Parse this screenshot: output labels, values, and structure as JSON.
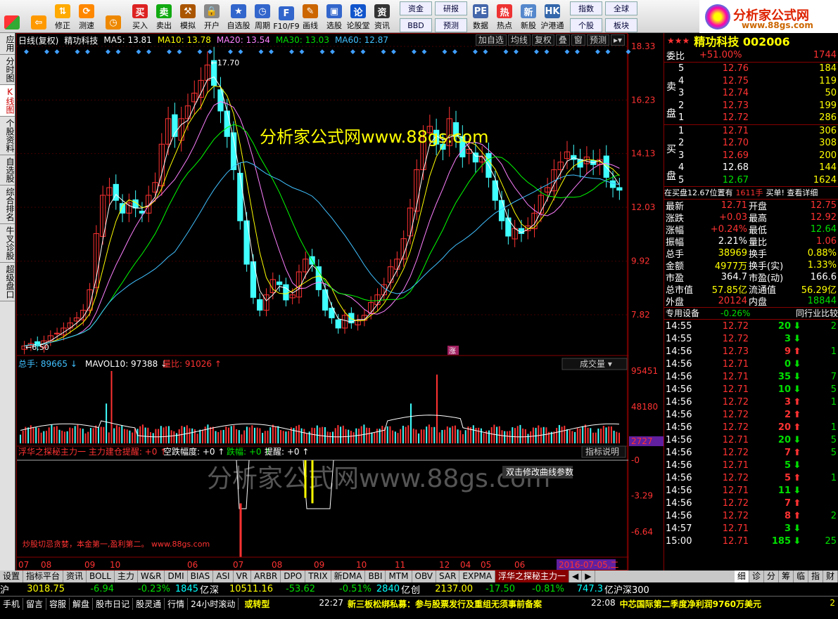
{
  "toolbar": {
    "buttons": [
      {
        "label": "",
        "icon": "windows-icon"
      },
      {
        "label": "",
        "icon": "back-arrow-icon"
      },
      {
        "label": "修正",
        "icon": "up-down-icon"
      },
      {
        "label": "测速",
        "icon": "speed-icon"
      },
      {
        "label": "",
        "icon": "clock-icon"
      },
      {
        "label": "买入",
        "icon": "buy-icon"
      },
      {
        "label": "卖出",
        "icon": "sell-icon"
      },
      {
        "label": "模拟",
        "icon": "hammer-icon"
      },
      {
        "label": "开户",
        "icon": "lock-icon"
      },
      {
        "label": "自选股",
        "icon": "star-folder-icon"
      },
      {
        "label": "周期",
        "icon": "clock-period-icon"
      },
      {
        "label": "F10/F9",
        "icon": "f10-icon"
      },
      {
        "label": "画线",
        "icon": "pencil-icon"
      },
      {
        "label": "选股",
        "icon": "select-stock-icon"
      },
      {
        "label": "论股堂",
        "icon": "forum-icon"
      },
      {
        "label": "资讯",
        "icon": "news-icon"
      }
    ],
    "boxes": [
      "资金",
      "研报",
      "BBD",
      "预测"
    ],
    "buttons2": [
      {
        "label": "数据",
        "icon": "pe-icon"
      },
      {
        "label": "热点",
        "icon": "hot-icon"
      },
      {
        "label": "新股",
        "icon": "new-stock-icon"
      },
      {
        "label": "沪港通",
        "icon": "hk-icon"
      }
    ],
    "boxes2": [
      "指数",
      "全球",
      "个股",
      "板块"
    ]
  },
  "logo": {
    "title": "分析家公式网",
    "url": "www.88gs.com"
  },
  "left_tabs": [
    "应用",
    "分时图",
    "K线图",
    "个股资料",
    "自选股",
    "综合排名",
    "牛叉诊股",
    "超级盘口"
  ],
  "price_header": {
    "period": "日线(复权)",
    "name": "精功科技",
    "ma5": "MA5: 13.81",
    "ma10": "MA10: 13.78",
    "ma20": "MA20: 13.54",
    "ma30": "MA30: 13.03",
    "ma60": "MA60: 12.87",
    "buttons": [
      "加自选",
      "均线",
      "复权",
      "叠",
      "窗",
      "预测"
    ],
    "high_label": "17.70",
    "low_label": "6.50",
    "watermark": "分析家公式网www.88gs.com",
    "zhang": "涨"
  },
  "price_axis": [
    "18.33",
    "16.23",
    "14.13",
    "12.03",
    "9.92",
    "7.82"
  ],
  "volume_header": {
    "total": "总手: 89665",
    "mavol": "MAVOL10: 97388",
    "liangbi": "量比: 91026",
    "select": "成交量"
  },
  "volume_axis": [
    "95451",
    "48180",
    "2727"
  ],
  "indicator_header": {
    "name": "浮华之探秘主力一",
    "t1": "主力建仓提醒: +0",
    "t2": "空跌幅度: +0",
    "t3": "跌幅: +0",
    "t4": "提醒: +0",
    "help": "指标说明"
  },
  "indicator_axis": [
    "-0",
    "-3.29",
    "-6.64"
  ],
  "indicator_tooltip": "双击修改曲线参数",
  "indicator_watermark": "分析家公式网www.88gs.com",
  "indicator_note": "炒股切忌贪婪，本金第一,盈利第二。 www.88gs.com",
  "date_axis": [
    "07",
    "08",
    "09",
    "10",
    "06",
    "07",
    "08",
    "09",
    "10",
    "11",
    "12",
    "04",
    "05",
    "06"
  ],
  "date_selected": "2016-07-05,二",
  "right": {
    "stars": "★★★",
    "title": "精功科技 002006",
    "weibi_label": "委比",
    "weibi": "+51.00%",
    "weicha": "1744",
    "sell": [
      {
        "n": "5",
        "p": "12.76",
        "v": "184"
      },
      {
        "n": "4",
        "p": "12.75",
        "v": "119"
      },
      {
        "n": "3",
        "p": "12.74",
        "v": "50"
      },
      {
        "n": "2",
        "p": "12.73",
        "v": "199"
      },
      {
        "n": "1",
        "p": "12.72",
        "v": "286"
      }
    ],
    "buy": [
      {
        "n": "1",
        "p": "12.71",
        "v": "306"
      },
      {
        "n": "2",
        "p": "12.70",
        "v": "308"
      },
      {
        "n": "3",
        "p": "12.69",
        "v": "200"
      },
      {
        "n": "4",
        "p": "12.68",
        "v": "144"
      },
      {
        "n": "5",
        "p": "12.67",
        "v": "1624"
      }
    ],
    "sell_label": "卖盘",
    "buy_label": "买盘",
    "notice": "在买盘12.67位置有",
    "notice_vol": "1611手",
    "notice_act": "买单! 查看详细",
    "quotes": [
      {
        "l1": "最新",
        "v1": "12.71",
        "l2": "开盘",
        "v2": "12.75",
        "c1": "red",
        "c2": "red"
      },
      {
        "l1": "涨跌",
        "v1": "+0.03",
        "l2": "最高",
        "v2": "12.92",
        "c1": "red",
        "c2": "red"
      },
      {
        "l1": "涨幅",
        "v1": "+0.24%",
        "l2": "最低",
        "v2": "12.64",
        "c1": "red",
        "c2": "grn"
      },
      {
        "l1": "振幅",
        "v1": "2.21%",
        "l2": "量比",
        "v2": "1.06",
        "c1": "wht",
        "c2": "red"
      },
      {
        "l1": "总手",
        "v1": "38969",
        "l2": "换手",
        "v2": "0.88%",
        "c1": "yel",
        "c2": "yel"
      },
      {
        "l1": "金额",
        "v1": "4977万",
        "l2": "换手(实)",
        "v2": "1.33%",
        "c1": "yel",
        "c2": "yel"
      },
      {
        "l1": "市盈",
        "v1": "364.7",
        "l2": "市盈(动)",
        "v2": "166.6",
        "c1": "wht",
        "c2": "wht"
      },
      {
        "l1": "总市值",
        "v1": "57.85亿",
        "l2": "流通值",
        "v2": "56.29亿",
        "c1": "yel",
        "c2": "yel"
      },
      {
        "l1": "外盘",
        "v1": "20124",
        "l2": "内盘",
        "v2": "18844",
        "c1": "red",
        "c2": "grn"
      }
    ],
    "industry": "专用设备",
    "industry_pct": "-0.26%",
    "compare": "同行业比较",
    "ticks": [
      {
        "t": "14:55",
        "p": "12.72",
        "v": "20",
        "d": "down"
      },
      {
        "t": "14:55",
        "p": "12.72",
        "v": "3",
        "d": "down"
      },
      {
        "t": "14:56",
        "p": "12.73",
        "v": "9",
        "d": "up"
      },
      {
        "t": "14:56",
        "p": "12.71",
        "v": "0",
        "d": "down"
      },
      {
        "t": "14:56",
        "p": "12.71",
        "v": "35",
        "d": "down"
      },
      {
        "t": "14:56",
        "p": "12.71",
        "v": "10",
        "d": "down"
      },
      {
        "t": "14:56",
        "p": "12.72",
        "v": "3",
        "d": "up"
      },
      {
        "t": "14:56",
        "p": "12.72",
        "v": "2",
        "d": "up"
      },
      {
        "t": "14:56",
        "p": "12.72",
        "v": "20",
        "d": "up"
      },
      {
        "t": "14:56",
        "p": "12.71",
        "v": "20",
        "d": "down"
      },
      {
        "t": "14:56",
        "p": "12.72",
        "v": "7",
        "d": "up"
      },
      {
        "t": "14:56",
        "p": "12.71",
        "v": "5",
        "d": "down"
      },
      {
        "t": "14:56",
        "p": "12.72",
        "v": "5",
        "d": "up"
      },
      {
        "t": "14:56",
        "p": "12.71",
        "v": "11",
        "d": "down"
      },
      {
        "t": "14:56",
        "p": "12.72",
        "v": "7",
        "d": "up"
      },
      {
        "t": "14:56",
        "p": "12.72",
        "v": "8",
        "d": "up"
      },
      {
        "t": "14:57",
        "p": "12.71",
        "v": "3",
        "d": "down"
      },
      {
        "t": "15:00",
        "p": "12.71",
        "v": "185",
        "d": "down"
      }
    ],
    "tick_right_nums": [
      "2",
      "",
      "1",
      "",
      "7",
      "5",
      "1",
      "",
      "1",
      "5",
      "5",
      "",
      "1",
      "",
      "",
      "2",
      "",
      "25"
    ]
  },
  "bottom_tabs": [
    "设置",
    "指标平台",
    "资讯",
    "BOLL",
    "主力",
    "W&R",
    "DMI",
    "BIAS",
    "ASI",
    "VR",
    "ARBR",
    "DPO",
    "TRIX",
    "新DMA",
    "BBI",
    "MTM",
    "OBV",
    "SAR",
    "EXPMA",
    "浮华之探秘主力一"
  ],
  "right_tabs": [
    "细",
    "诊",
    "分",
    "筹",
    "临",
    "指",
    "财"
  ],
  "index_bar": {
    "sh_label": "沪",
    "sh": "3018.75",
    "sh_chg": "-6.94",
    "sh_pct": "-0.23%",
    "sh_amt": "1845",
    "sh_unit": "亿",
    "sz_label": "深",
    "sz": "10511.16",
    "sz_chg": "-53.62",
    "sz_pct": "-0.51%",
    "sz_amt": "2840",
    "sz_unit": "亿",
    "cy_label": "创",
    "cy": "2137.00",
    "cy_chg": "-17.50",
    "cy_pct": "-0.81%",
    "hs_amt": "747.3",
    "hs_label": "亿沪深300"
  },
  "status": {
    "tabs": [
      "手机",
      "留言",
      "容服",
      "解盘",
      "股市日记",
      "股灵通",
      "行情",
      "24小时滚动"
    ],
    "label": "或转型",
    "news1_time": "22:27",
    "news1": "新三板松绑私募：参与股票发行及重组无须事前备案",
    "news2_time": "22:08",
    "news2": "中芯国际第二季度净利润9760万美元",
    "end": "2"
  },
  "colors": {
    "up": "#ff3232",
    "down": "#00e000",
    "ma5": "#ffffff",
    "ma10": "#ffff00",
    "ma20": "#ff80ff",
    "ma30": "#00ff00",
    "ma60": "#40c0ff"
  },
  "chart_data": {
    "type": "candlestick",
    "title": "精功科技 日线(复权)",
    "ylim": [
      6.5,
      18.33
    ],
    "close": [
      6.6,
      6.7,
      6.6,
      6.8,
      7.0,
      7.1,
      7.3,
      7.5,
      7.7,
      8.0,
      8.8,
      11.0,
      12.5,
      12.8,
      12.3,
      11.8,
      12.2,
      12.0,
      11.8,
      12.5,
      13.0,
      14.5,
      15.5,
      14.8,
      15.5,
      16.0,
      16.5,
      17.0,
      17.6,
      16.8,
      15.8,
      14.8,
      13.5,
      11.5,
      9.8,
      8.5,
      8.0,
      8.6,
      9.2,
      9.0,
      8.4,
      8.6,
      9.5,
      10.0,
      9.8,
      8.8,
      8.0,
      7.7,
      7.3,
      7.8,
      7.5,
      7.6,
      7.8,
      8.3,
      8.6,
      9.0,
      9.7,
      10.0,
      10.8,
      12.0,
      13.5,
      14.8,
      15.2,
      14.5,
      14.3,
      15.5,
      14.8,
      14.0,
      14.3,
      13.8,
      14.0,
      13.2,
      12.3,
      11.5,
      10.9,
      11.2,
      11.0,
      11.3,
      11.8,
      12.5,
      12.8,
      13.5,
      13.8,
      14.2,
      13.9,
      13.6,
      14.0,
      13.7,
      13.9,
      13.2,
      12.8,
      12.7
    ],
    "volume_ylim": [
      0,
      95451
    ],
    "indicator_ylim": [
      -9,
      0
    ]
  }
}
